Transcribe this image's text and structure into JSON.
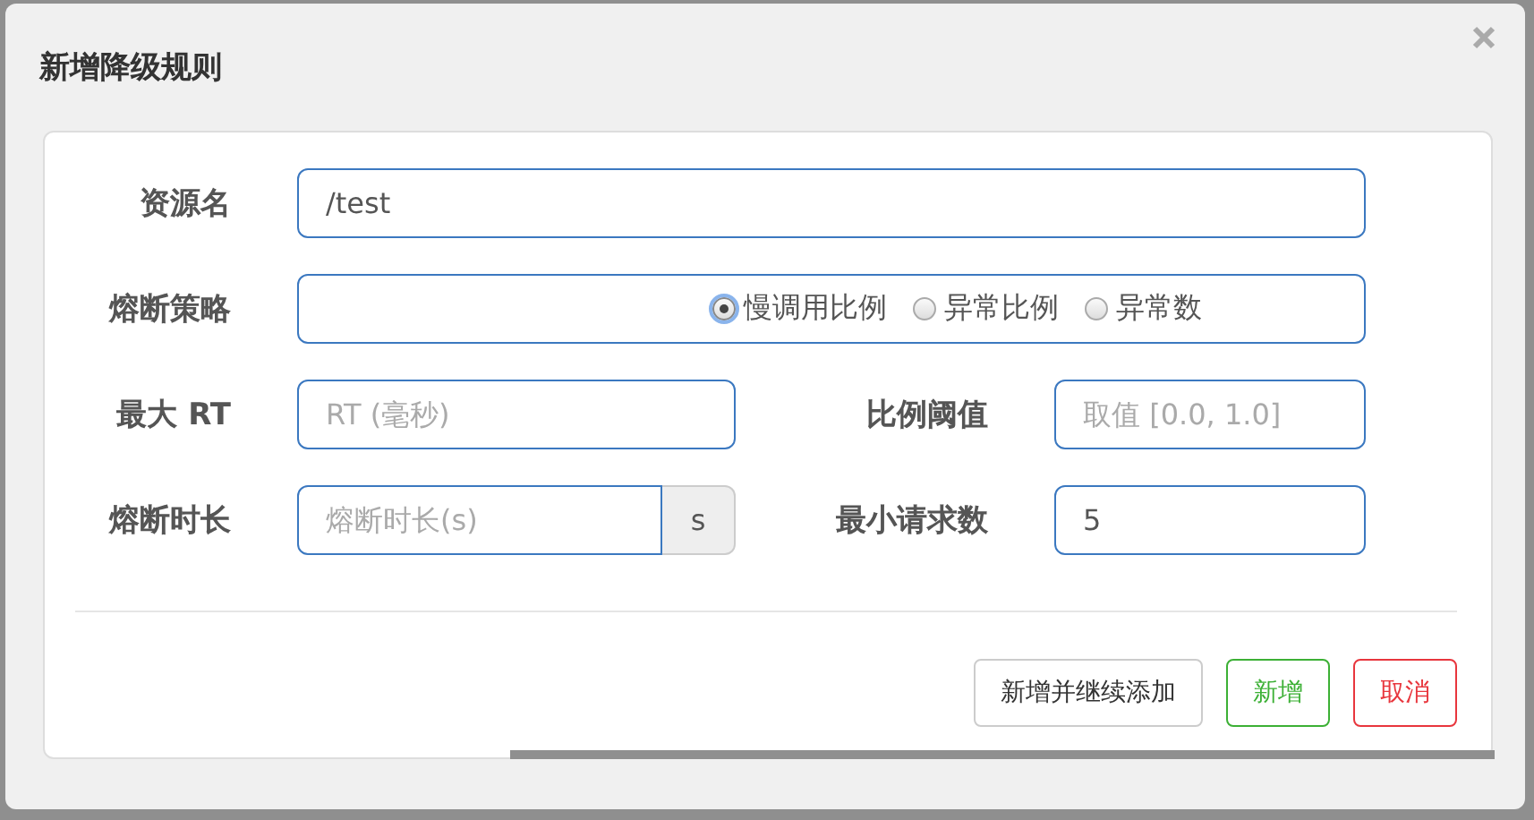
{
  "dialog": {
    "title": "新增降级规则",
    "fields": [
      {
        "kind": "text",
        "label": "资源名",
        "value": "/test"
      },
      {
        "kind": "radio",
        "label": "熔断策略",
        "options": [
          {
            "label": "慢调用比例",
            "selected": true
          },
          {
            "label": "异常比例",
            "selected": false
          },
          {
            "label": "异常数",
            "selected": false
          }
        ]
      },
      {
        "kind": "text",
        "label": "最大 RT",
        "placeholder": "RT (毫秒)"
      },
      {
        "kind": "text",
        "label": "比例阈值",
        "placeholder": "取值 [0.0, 1.0]"
      },
      {
        "kind": "addon",
        "label": "熔断时长",
        "placeholder": "熔断时长(s)",
        "addon": "s"
      },
      {
        "kind": "text",
        "label": "最小请求数",
        "value": "5"
      }
    ],
    "buttons": [
      {
        "label": "新增并继续添加",
        "kind": "default"
      },
      {
        "label": "新增",
        "kind": "success"
      },
      {
        "label": "取消",
        "kind": "danger"
      }
    ]
  }
}
